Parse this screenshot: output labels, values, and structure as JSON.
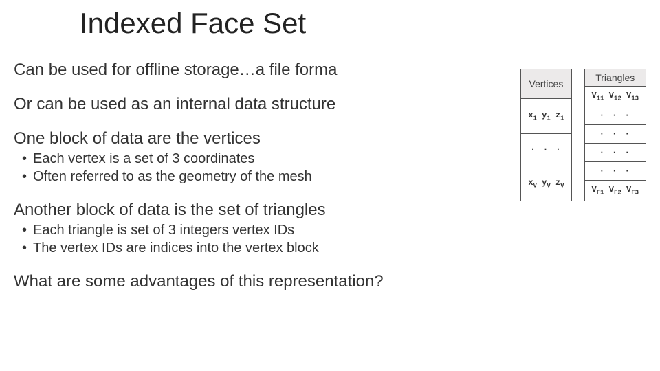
{
  "title": "Indexed Face Set",
  "paras": {
    "p1": "Can be used for offline storage…a file forma",
    "p2": "Or can be used as an internal data structure",
    "p3": "One block of data are the vertices",
    "p4": "Another block of data is the set of triangles",
    "p5": "What are some advantages of this representation?"
  },
  "bullets1": {
    "b1": "Each vertex is a set of 3 coordinates",
    "b2": "Often referred to as the geometry of the mesh"
  },
  "bullets2": {
    "b1": "Each triangle is set of 3 integers vertex IDs",
    "b2": "The vertex IDs are indices into the vertex block"
  },
  "tables": {
    "vertices": {
      "header": "Vertices",
      "rows": [
        [
          "x",
          "1",
          "y",
          "1",
          "z",
          "1"
        ],
        "dots",
        [
          "x",
          "V",
          "y",
          "V",
          "z",
          "V"
        ]
      ]
    },
    "triangles": {
      "header": "Triangles",
      "rows": [
        [
          "V",
          "11",
          "V",
          "12",
          "V",
          "13"
        ],
        "dots",
        "dots",
        "dots",
        "dots",
        [
          "V",
          "F1",
          "V",
          "F2",
          "V",
          "F3"
        ]
      ]
    }
  }
}
